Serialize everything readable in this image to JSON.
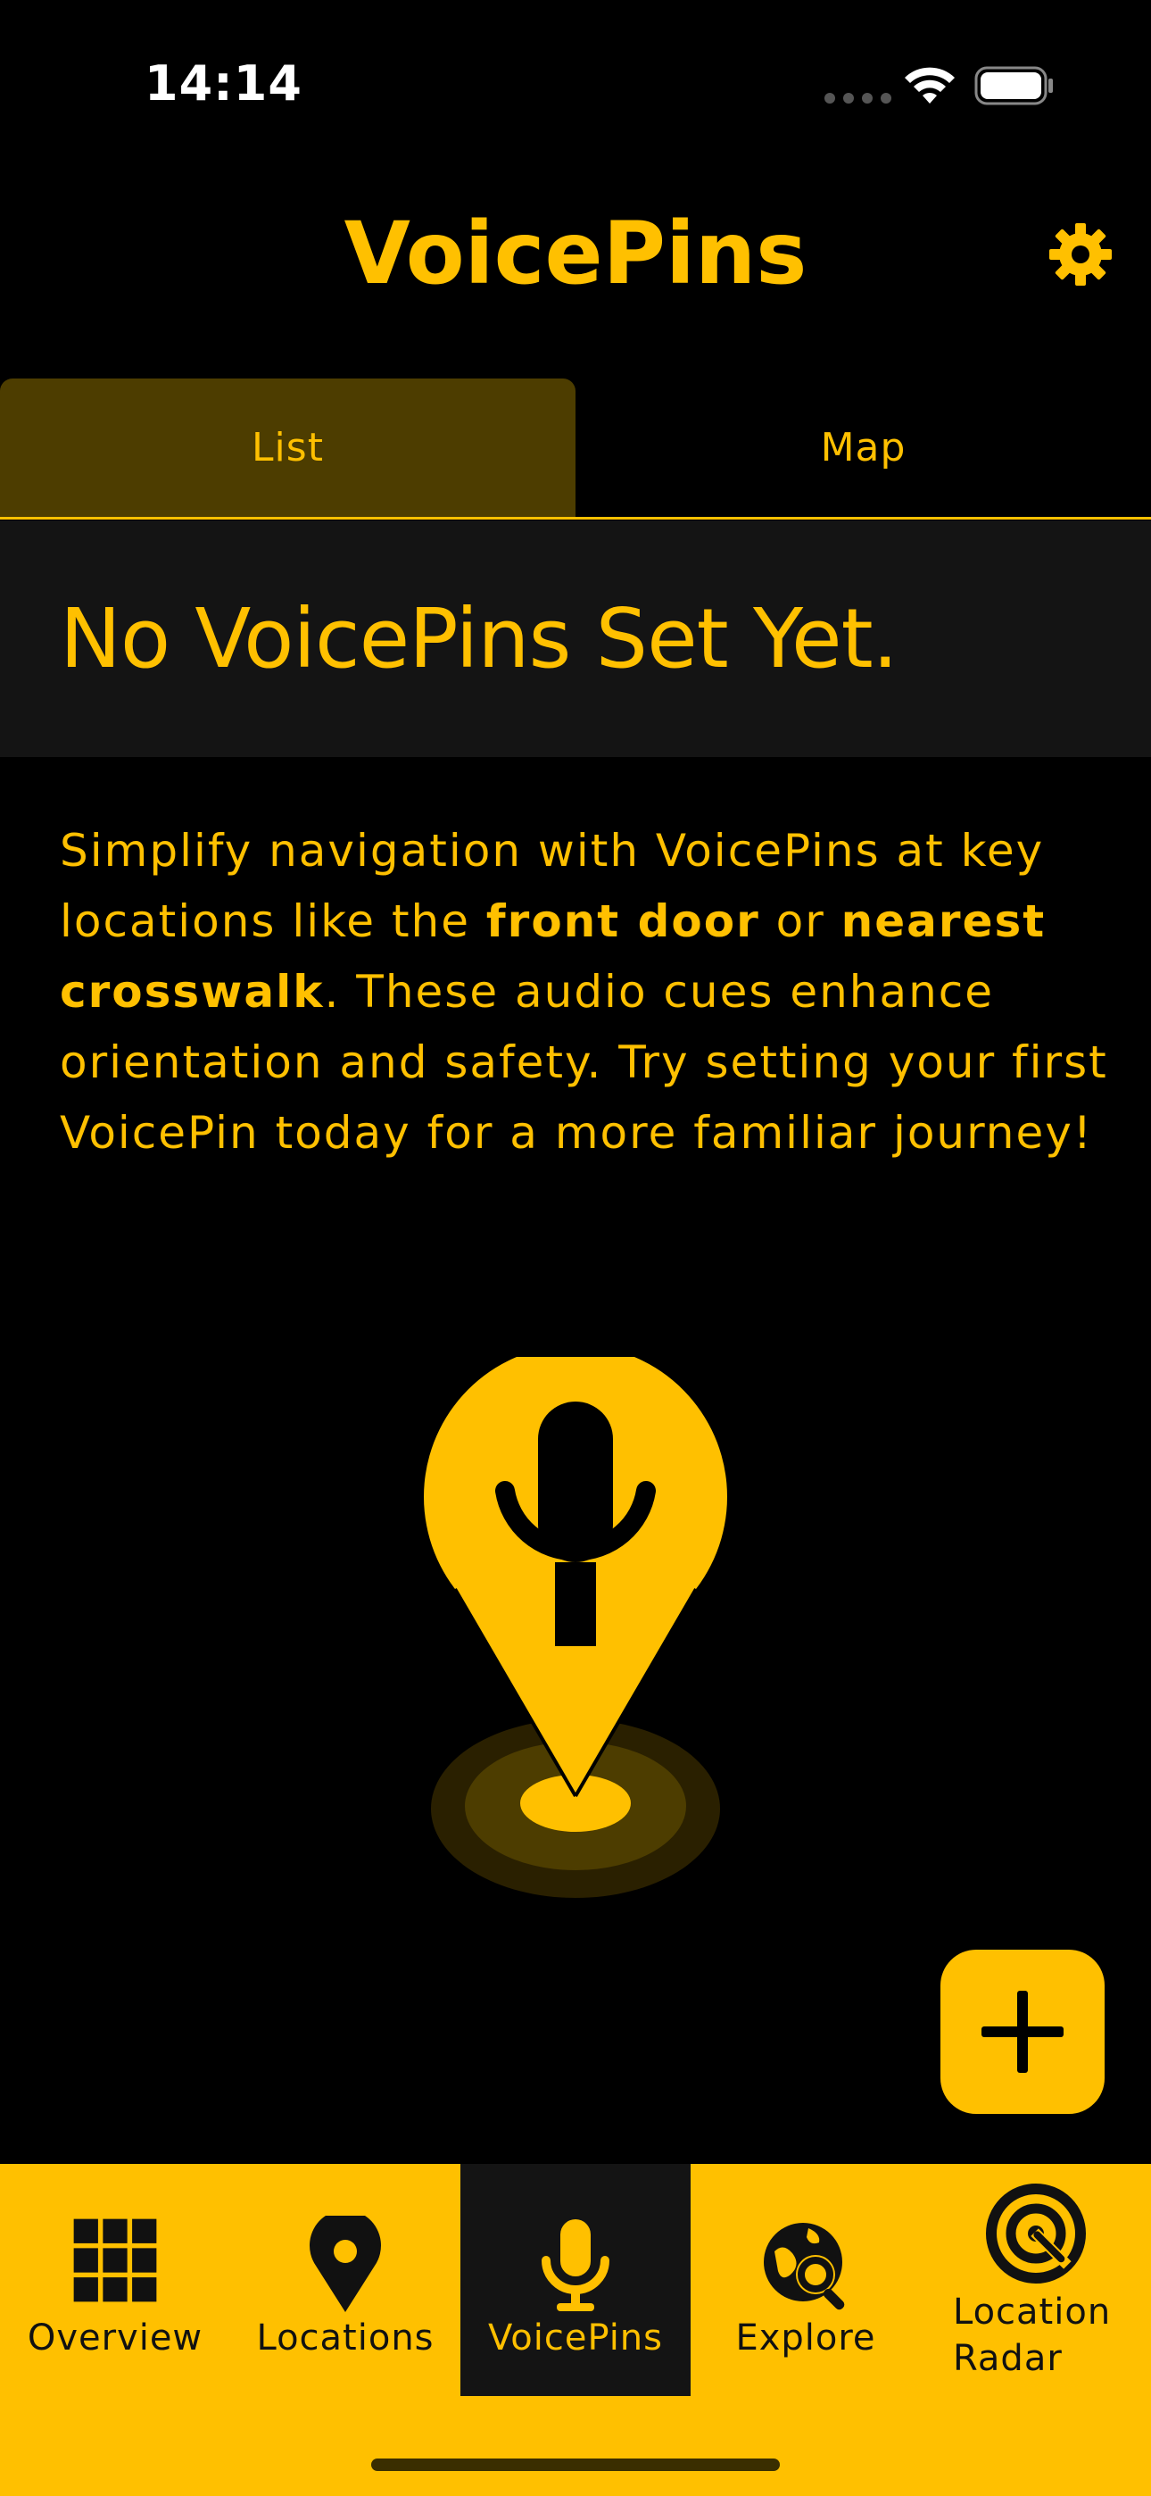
{
  "status_bar": {
    "time": "14:14"
  },
  "header": {
    "title": "VoicePins",
    "settings_icon": "gear-icon"
  },
  "tabs": [
    {
      "label": "List",
      "selected": true
    },
    {
      "label": "Map",
      "selected": false
    }
  ],
  "empty_state": {
    "title": "No VoicePins Set Yet.",
    "desc_part1": "Simplify navigation with VoicePins at key locations like the ",
    "desc_bold1": "front door",
    "desc_part2": " or ",
    "desc_bold2": "nearest crosswalk",
    "desc_part3": ". These audio cues enhance orientation and safety. Try setting your first VoicePin today for a more familiar journey!",
    "illustration_icon": "voice-pin-icon"
  },
  "fab": {
    "icon": "plus-icon"
  },
  "bottom_nav": {
    "items": [
      {
        "label": "Overview",
        "icon": "grid-icon"
      },
      {
        "label": "Locations",
        "icon": "map-pin-icon"
      },
      {
        "label": "VoicePins",
        "icon": "microphone-icon",
        "active": true
      },
      {
        "label": "Explore",
        "icon": "globe-search-icon"
      },
      {
        "label": "Location Radar",
        "icon": "radar-icon"
      }
    ]
  },
  "colors": {
    "accent": "#FFC000",
    "background": "#000000",
    "banner": "#141414",
    "selected_tab": "#4D3D00"
  }
}
